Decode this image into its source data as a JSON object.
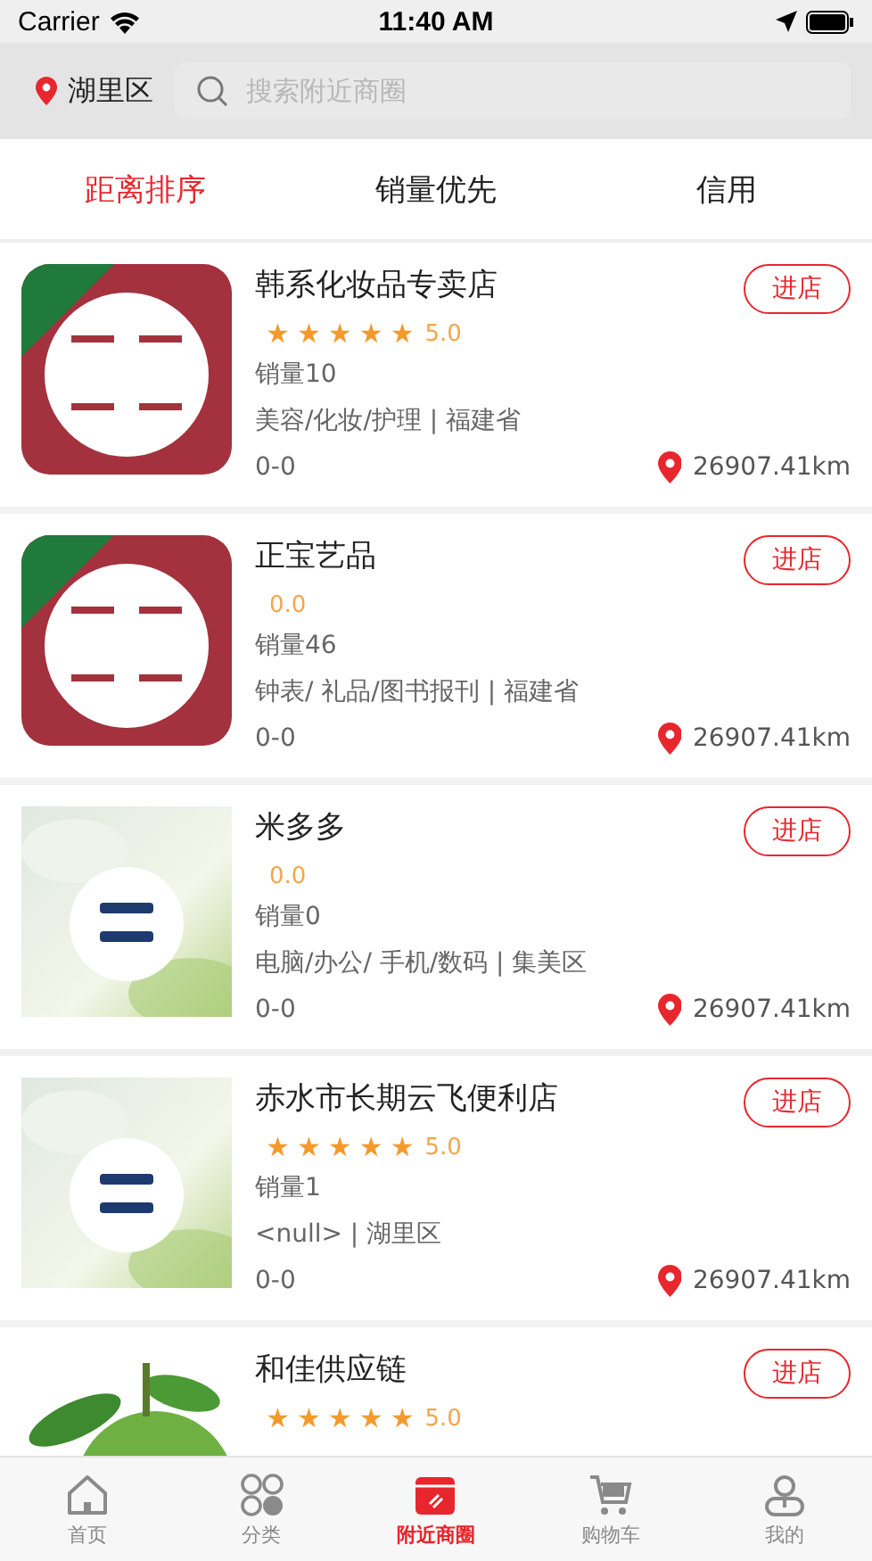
{
  "status_bar": {
    "carrier": "Carrier",
    "time": "11:40 AM"
  },
  "header": {
    "location": "湖里区",
    "search": {
      "placeholder": "搜索附近商圈"
    }
  },
  "sort_tabs": [
    {
      "label": "距离排序",
      "selected": true
    },
    {
      "label": "销量优先",
      "selected": false
    },
    {
      "label": "信用",
      "selected": false
    }
  ],
  "stores": [
    {
      "kind": "logo",
      "name": "韩系化妆品专卖店",
      "stars": 5,
      "rating": "5.0",
      "sales": "销量10",
      "category": "美容/化妆/护理 | 福建省",
      "hours": "0-0",
      "distance": "26907.41km",
      "button": "进店"
    },
    {
      "kind": "logo",
      "name": "正宝艺品",
      "rating": "0.0",
      "sales": "销量46",
      "category": "钟表/ 礼品/图书报刊 | 福建省",
      "hours": "0-0",
      "distance": "26907.41km",
      "button": "进店"
    },
    {
      "kind": "placeholder",
      "name": "米多多",
      "rating": "0.0",
      "sales": "销量0",
      "category": "电脑/办公/ 手机/数码 | 集美区",
      "hours": "0-0",
      "distance": "26907.41km",
      "button": "进店"
    },
    {
      "kind": "placeholder",
      "name": "赤水市长期云飞便利店",
      "stars": 5,
      "rating": "5.0",
      "sales": "销量1",
      "category": "<null> | 湖里区",
      "hours": "0-0",
      "distance": "26907.41km",
      "button": "进店"
    },
    {
      "name": "和佳供应链",
      "stars": 5,
      "rating": "5.0",
      "button": "进店"
    }
  ],
  "tab_bar": [
    {
      "label": "首页",
      "kind": "home",
      "selected": false
    },
    {
      "label": "分类",
      "kind": "category",
      "selected": false
    },
    {
      "label": "附近商圈",
      "kind": "store",
      "selected": true
    },
    {
      "label": "购物车",
      "kind": "cart",
      "selected": false
    },
    {
      "label": "我的",
      "kind": "person",
      "selected": false
    }
  ]
}
